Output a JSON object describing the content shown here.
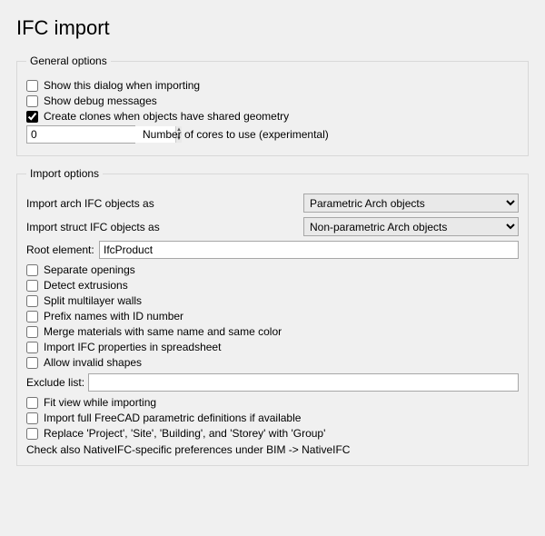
{
  "title": "IFC import",
  "general": {
    "legend": "General options",
    "show_dialog": "Show this dialog when importing",
    "show_debug": "Show debug messages",
    "create_clones": "Create clones when objects have shared geometry",
    "cores_value": "0",
    "cores_label": "Number of cores to use (experimental)"
  },
  "import": {
    "legend": "Import options",
    "arch_label": "Import arch IFC objects as",
    "arch_value": "Parametric Arch objects",
    "struct_label": "Import struct IFC objects as",
    "struct_value": "Non-parametric Arch objects",
    "root_label": "Root element:",
    "root_value": "IfcProduct",
    "separate_openings": "Separate openings",
    "detect_extrusions": "Detect extrusions",
    "split_walls": "Split multilayer walls",
    "prefix_names": "Prefix names with ID number",
    "merge_materials": "Merge materials with same name and same color",
    "import_props": "Import IFC properties in spreadsheet",
    "allow_invalid": "Allow invalid shapes",
    "exclude_label": "Exclude list:",
    "exclude_value": "",
    "fit_view": "Fit view while importing",
    "import_full": "Import full FreeCAD parametric definitions if available",
    "replace_group": "Replace 'Project', 'Site', 'Building', and 'Storey' with 'Group'",
    "note": "Check also NativeIFC-specific preferences under BIM -> NativeIFC"
  }
}
